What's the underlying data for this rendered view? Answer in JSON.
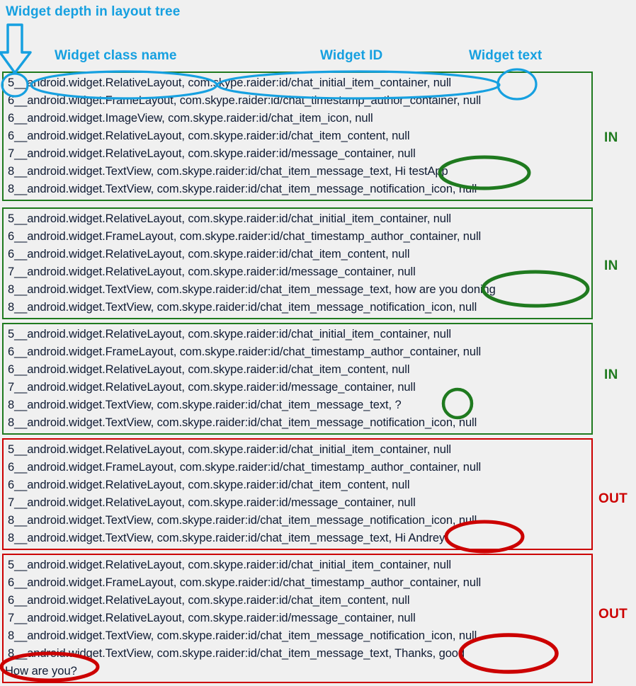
{
  "annotations": {
    "depth": "Widget depth in layout tree",
    "class_name": "Widget class name",
    "widget_id": "Widget ID",
    "widget_text": "Widget text",
    "arrow": "down-arrow-icon"
  },
  "colors": {
    "annotation_blue": "#16A0E0",
    "in_green": "#1f7a1f",
    "out_red": "#cc0000",
    "background": "#f0f0f0",
    "line_text": "#0f1b33"
  },
  "verdicts": {
    "in": "IN",
    "out": "OUT"
  },
  "blocks": [
    {
      "verdict": "IN",
      "kind": "in",
      "lines": [
        "5__android.widget.RelativeLayout, com.skype.raider:id/chat_initial_item_container, null",
        "6__android.widget.FrameLayout, com.skype.raider:id/chat_timestamp_author_container, null",
        "6__android.widget.ImageView, com.skype.raider:id/chat_item_icon, null",
        "6__android.widget.RelativeLayout, com.skype.raider:id/chat_item_content, null",
        "7__android.widget.RelativeLayout, com.skype.raider:id/message_container, null",
        "8__android.widget.TextView, com.skype.raider:id/chat_item_message_text, Hi testApp",
        "8__android.widget.TextView, com.skype.raider:id/chat_item_message_notification_icon, null"
      ],
      "highlighted_text": "Hi testApp"
    },
    {
      "verdict": "IN",
      "kind": "in",
      "lines": [
        "5__android.widget.RelativeLayout, com.skype.raider:id/chat_initial_item_container, null",
        "6__android.widget.FrameLayout, com.skype.raider:id/chat_timestamp_author_container, null",
        "6__android.widget.RelativeLayout, com.skype.raider:id/chat_item_content, null",
        "7__android.widget.RelativeLayout, com.skype.raider:id/message_container, null",
        "8__android.widget.TextView, com.skype.raider:id/chat_item_message_text, how are you doning",
        "8__android.widget.TextView, com.skype.raider:id/chat_item_message_notification_icon, null"
      ],
      "highlighted_text": "how are you doning"
    },
    {
      "verdict": "IN",
      "kind": "in",
      "lines": [
        "5__android.widget.RelativeLayout, com.skype.raider:id/chat_initial_item_container, null",
        "6__android.widget.FrameLayout, com.skype.raider:id/chat_timestamp_author_container, null",
        "6__android.widget.RelativeLayout, com.skype.raider:id/chat_item_content, null",
        "7__android.widget.RelativeLayout, com.skype.raider:id/message_container, null",
        "8__android.widget.TextView, com.skype.raider:id/chat_item_message_text, ?",
        "8__android.widget.TextView, com.skype.raider:id/chat_item_message_notification_icon, null"
      ],
      "highlighted_text": "?"
    },
    {
      "verdict": "OUT",
      "kind": "out",
      "lines": [
        "5__android.widget.RelativeLayout, com.skype.raider:id/chat_initial_item_container, null",
        "6__android.widget.FrameLayout, com.skype.raider:id/chat_timestamp_author_container, null",
        "6__android.widget.RelativeLayout, com.skype.raider:id/chat_item_content, null",
        "7__android.widget.RelativeLayout, com.skype.raider:id/message_container, null",
        "8__android.widget.TextView, com.skype.raider:id/chat_item_message_notification_icon, null",
        "8__android.widget.TextView, com.skype.raider:id/chat_item_message_text, Hi Andrey"
      ],
      "highlighted_text": "Hi Andrey"
    },
    {
      "verdict": "OUT",
      "kind": "out",
      "lines": [
        "5__android.widget.RelativeLayout, com.skype.raider:id/chat_initial_item_container, null",
        "6__android.widget.FrameLayout, com.skype.raider:id/chat_timestamp_author_container, null",
        "6__android.widget.RelativeLayout, com.skype.raider:id/chat_item_content, null",
        "7__android.widget.RelativeLayout, com.skype.raider:id/message_container, null",
        "8__android.widget.TextView, com.skype.raider:id/chat_item_message_notification_icon, null",
        "8__android.widget.TextView, com.skype.raider:id/chat_item_message_text, Thanks, good"
      ],
      "wrapped_line": "How are you?",
      "highlighted_text": "Thanks, good"
    }
  ]
}
